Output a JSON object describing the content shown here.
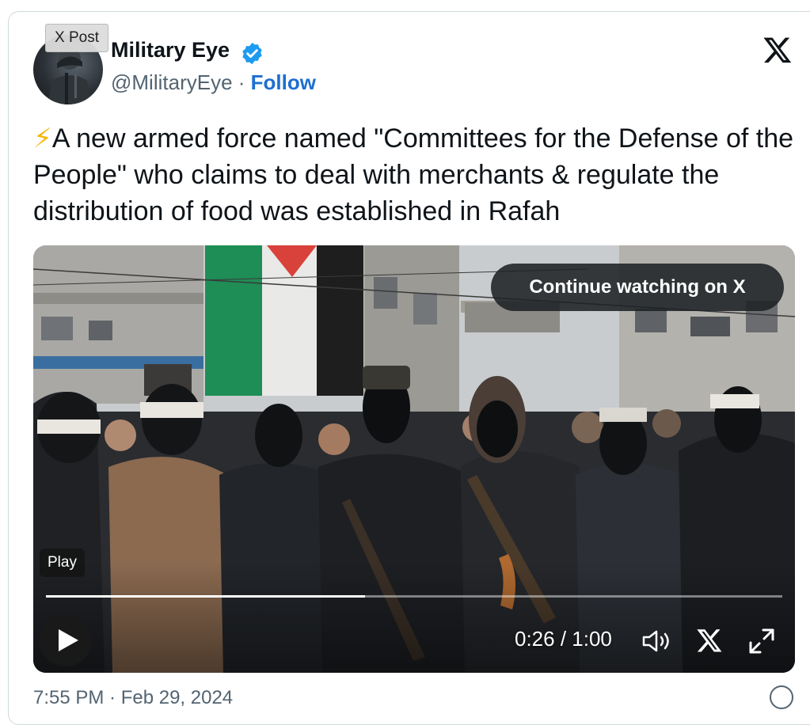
{
  "embed": {
    "tag": "X Post",
    "author": {
      "name": "Military Eye",
      "handle": "@MilitaryEye",
      "separator": " · ",
      "follow_label": "Follow",
      "verified": true
    },
    "icons": {
      "brand": "x-logo-icon",
      "verified": "verified-badge-icon",
      "lightning": "lightning-emoji-icon"
    },
    "tweet": {
      "emoji": "⚡",
      "text": "A new armed force named \"Committees for the Defense of the People\" who claims to deal with merchants & regulate the distribution of food was established in Rafah"
    },
    "video": {
      "continue_label": "Continue watching on X",
      "play_tooltip": "Play",
      "current_time": "0:26",
      "time_separator": " / ",
      "duration": "1:00",
      "progress_fraction": 0.433,
      "controls": [
        "play-icon",
        "volume-icon",
        "x-logo-icon",
        "fullscreen-icon"
      ]
    },
    "timestamp": "7:55 PM · Feb 29, 2024"
  },
  "colors": {
    "link": "#1d6fd1",
    "verified": "#1d9bf0",
    "text": "#0f1419",
    "secondary": "#536471"
  }
}
